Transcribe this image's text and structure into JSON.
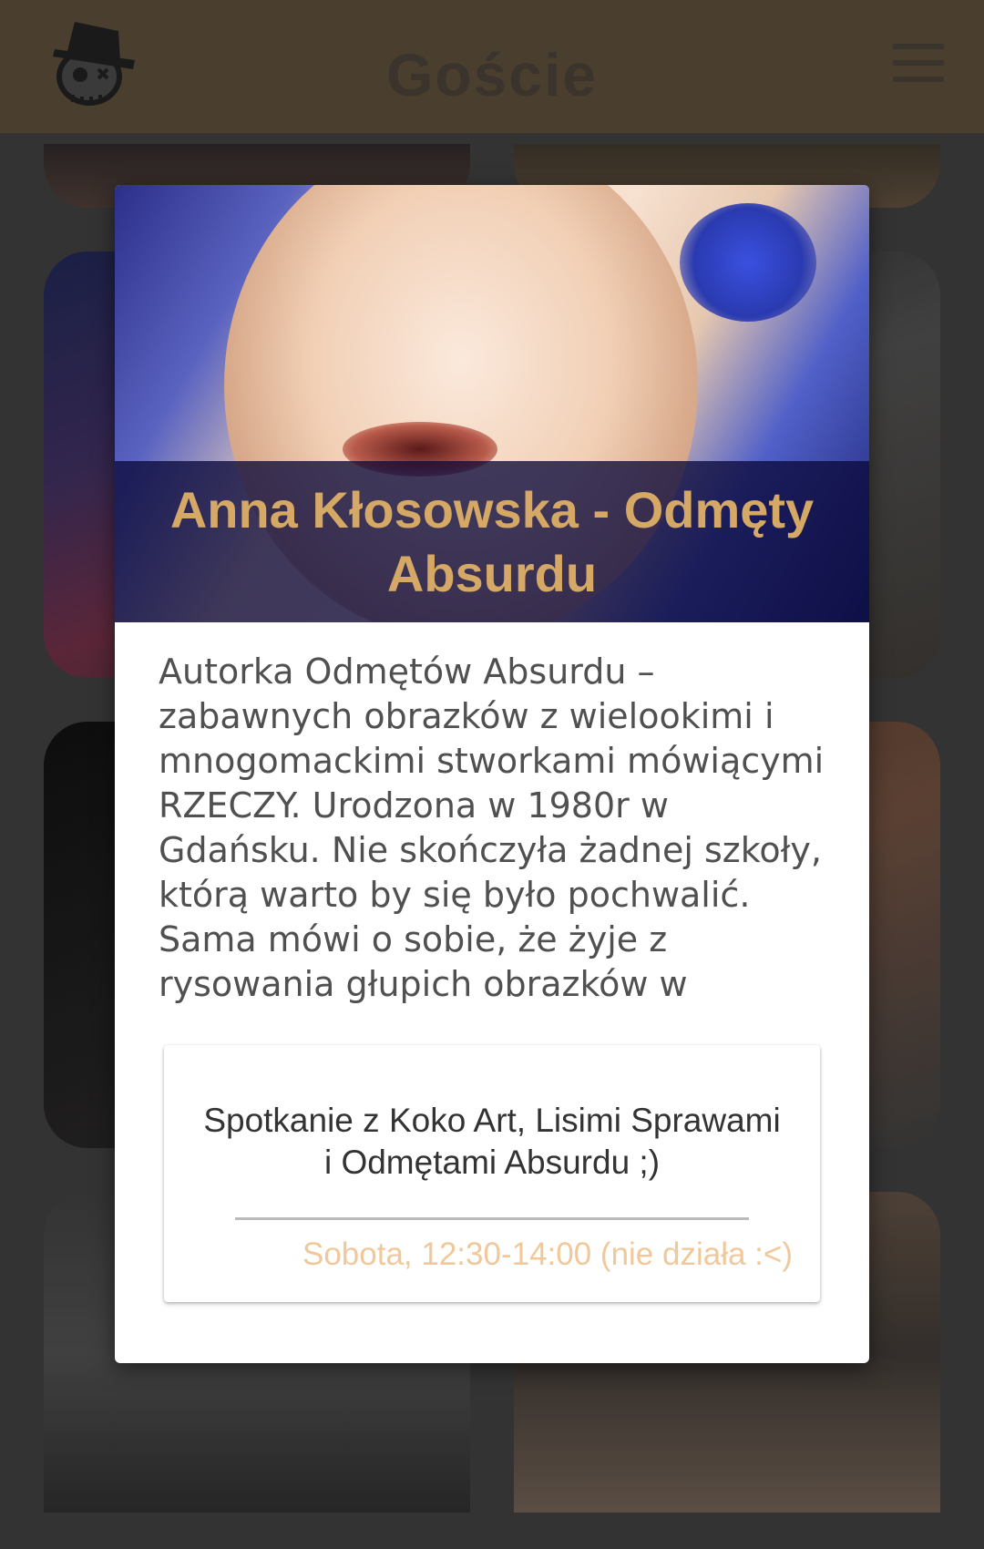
{
  "header": {
    "title": "Goście",
    "logo_icon": "skull-hat-logo-icon",
    "menu_icon": "hamburger-menu-icon",
    "background_color": "#4a3f2e"
  },
  "dialog": {
    "name": "Anna Kłosowska - Odmęty Absurdu",
    "bio": "Autorka Odmętów Absurdu – zabawnych obrazków z wielookimi i mnogomackimi stworkami mówiącymi RZECZY. Urodzona w 1980r w Gdańsku. Nie skończyła żadnej szkoły, którą warto by się było pochwalić. Sama mówi o sobie, że żyje z rysowania głupich obrazków w",
    "title_color": "#d5a866",
    "event": {
      "title": "Spotkanie z Koko Art, Lisimi Sprawami i Odmętami Absurdu ;)",
      "time": "Sobota, 12:30-14:00 (nie działa :<)",
      "time_color": "#f0c89a"
    }
  }
}
